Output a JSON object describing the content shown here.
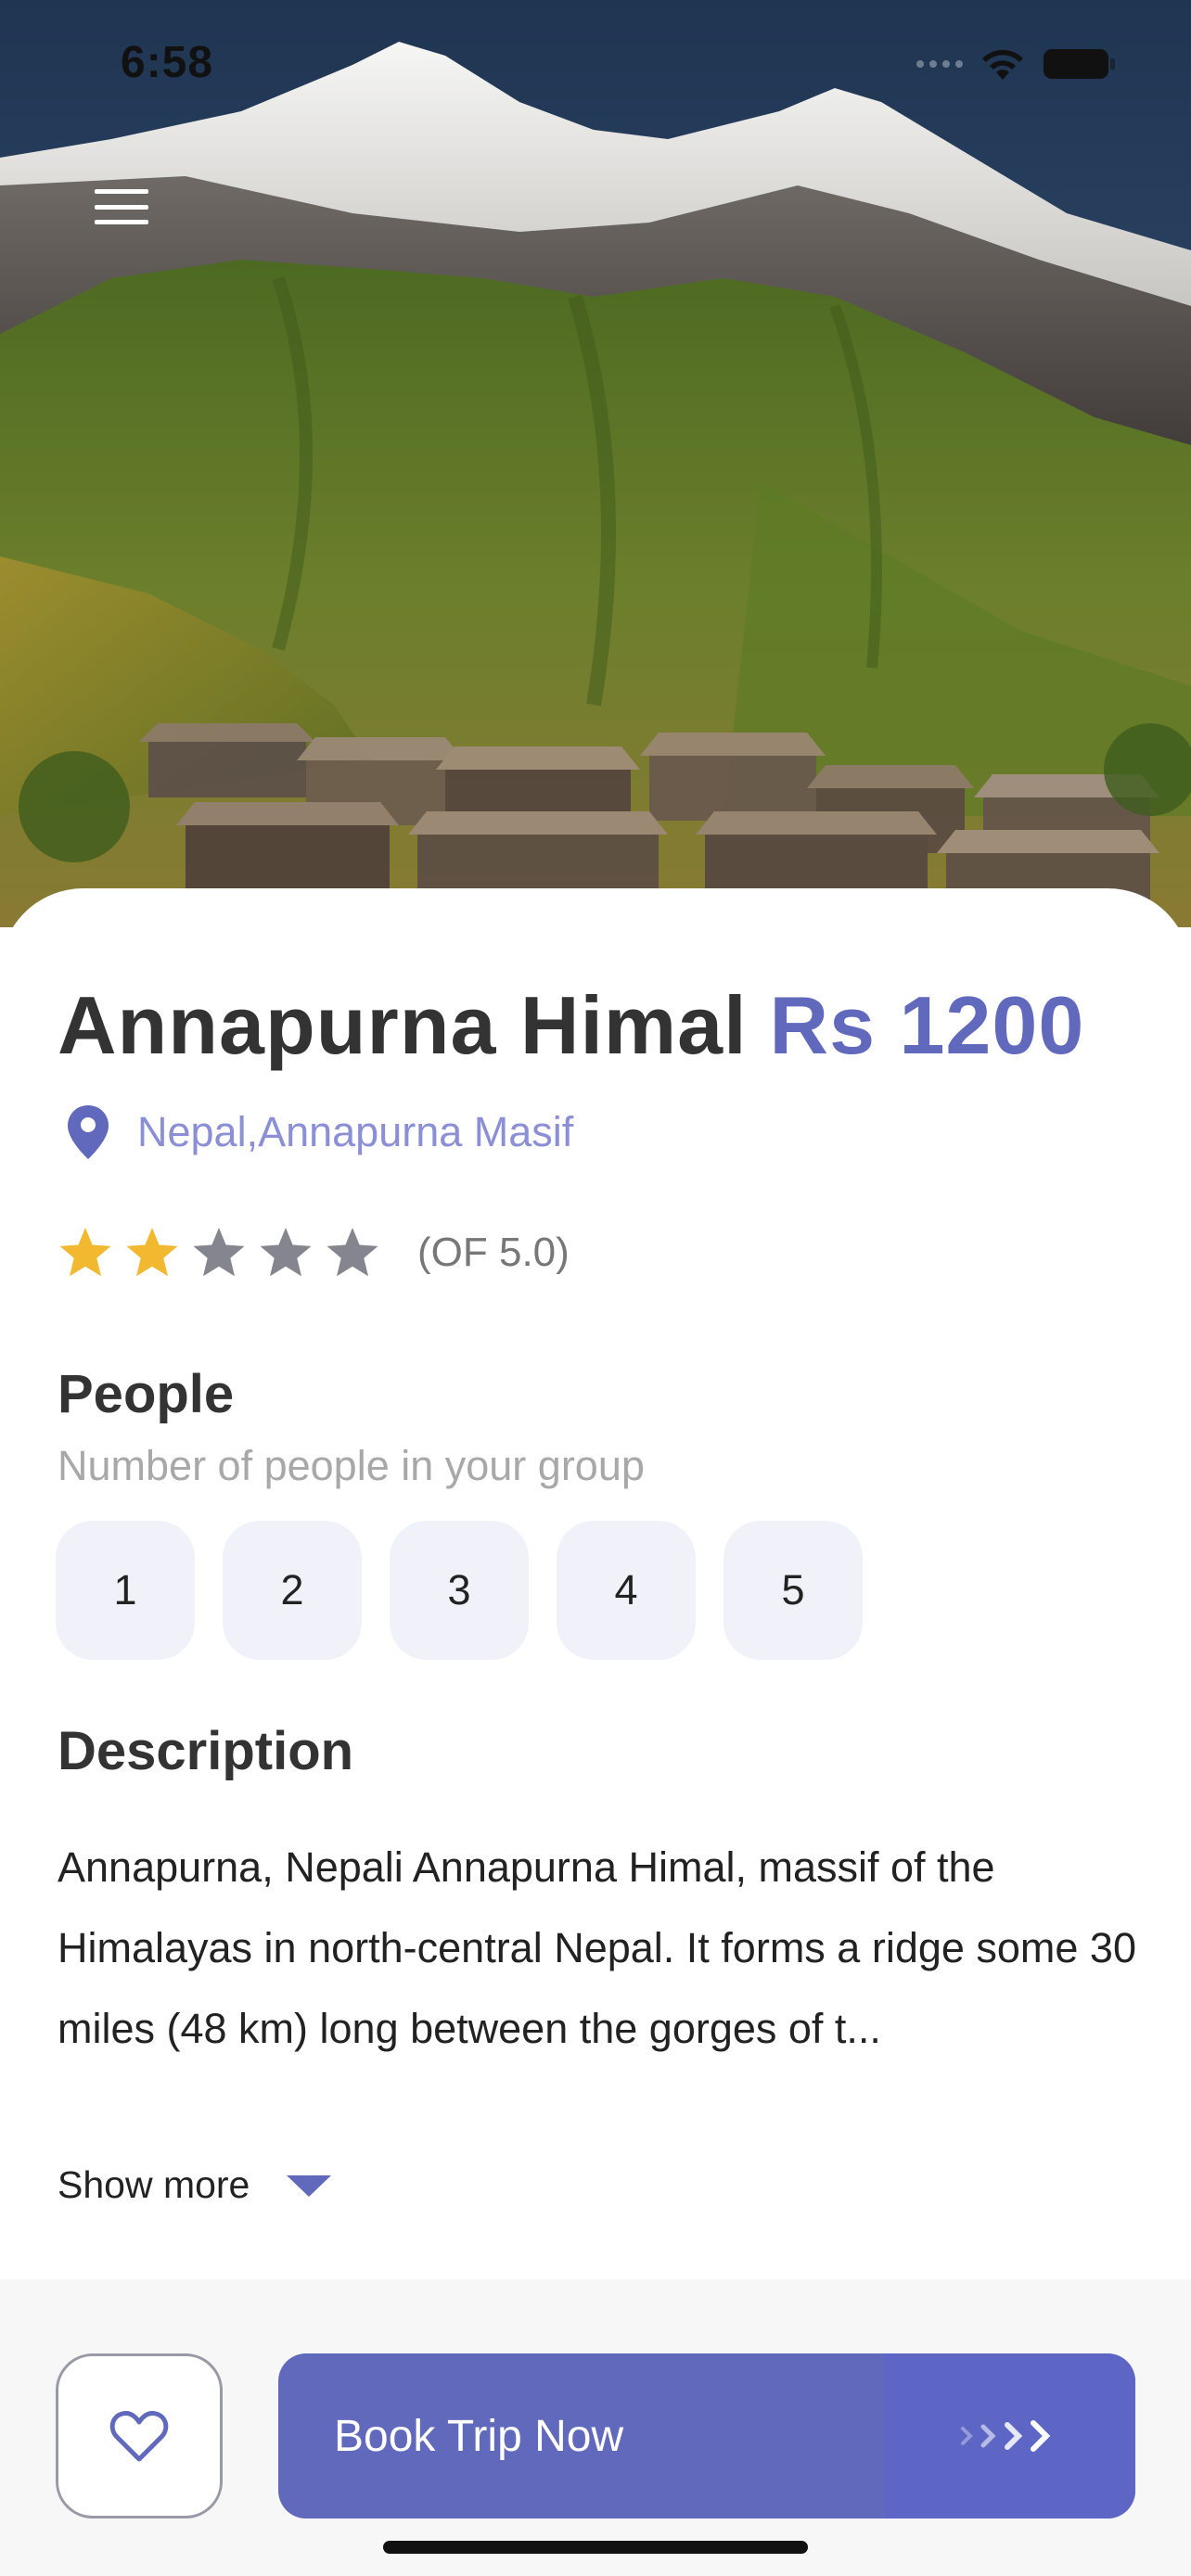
{
  "status_bar": {
    "time": "6:58"
  },
  "hero": {
    "image": "Annapurna mountain landscape with village"
  },
  "trip": {
    "title": "Annapurna Himal",
    "price": "Rs 1200",
    "location": "Nepal,Annapurna Masif",
    "rating": {
      "value": 2,
      "max": 5,
      "label": "(OF 5.0)"
    }
  },
  "people": {
    "title": "People",
    "subtitle": "Number of people in your group",
    "options": [
      "1",
      "2",
      "3",
      "4",
      "5"
    ]
  },
  "description": {
    "title": "Description",
    "text": "Annapurna, Nepali Annapurna Himal, massif of the Himalayas in north-central Nepal. It forms a ridge some 30 miles (48 km) long between the gorges of t...",
    "show_more": "Show more"
  },
  "actions": {
    "book_label": "Book Trip Now"
  },
  "colors": {
    "accent": "#6169bd",
    "location": "#8a8fd6",
    "star_filled": "#f2b830",
    "star_empty": "#85858f",
    "chip_bg": "#f1f2f9"
  },
  "icons": [
    "menu-icon",
    "location-pin-icon",
    "star-icon",
    "chevron-down-icon",
    "heart-icon",
    "arrows-right-icon",
    "wifi-icon",
    "battery-icon"
  ]
}
